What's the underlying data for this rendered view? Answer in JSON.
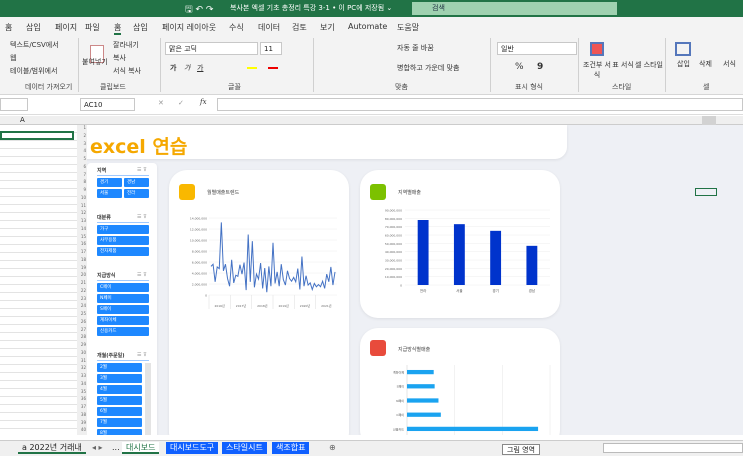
{
  "window": {
    "title": "복사본 엑셀 기초 총정리 특강 3-1 • 이 PC에 저장됨 ⌄",
    "search_placeholder": "검색"
  },
  "ribbon_tabs": [
    "홈",
    "삽입",
    "페이지",
    "파일",
    "홈",
    "삽입",
    "페이지 레이아웃",
    "수식",
    "데이터",
    "검토",
    "보기",
    "Automate",
    "도움말"
  ],
  "ribbon": {
    "data_group": {
      "items": [
        "텍스트/CSV에서",
        "웹",
        "테이블/범위에서"
      ],
      "label": "데이터 가져오기"
    },
    "clipboard": {
      "paste": "붙여넣기",
      "cut": "잘라내기",
      "copy": "복사",
      "format_painter": "서식 복사",
      "label": "클립보드"
    },
    "font": {
      "name": "맑은 고딕",
      "size": "11",
      "label": "글꼴",
      "bold": "가",
      "italic": "가",
      "underline": "가"
    },
    "align": {
      "wrap": "자동 줄 바꿈",
      "merge": "병합하고 가운데 맞춤",
      "label": "맞춤"
    },
    "number": {
      "format": "일반",
      "percent": "%",
      "comma": "9",
      "label": "표시 형식"
    },
    "styles": {
      "cond": "조건부 서식",
      "table": "표 서식",
      "cell": "셀 스타일",
      "label": "스타일"
    },
    "cells": {
      "insert": "삽입",
      "delete": "삭제",
      "format": "서식",
      "label": "셀"
    }
  },
  "formula_bar": {
    "name_box": "AC10",
    "fx": "fx",
    "value": ""
  },
  "left_pane": {
    "col": "A"
  },
  "dashboard": {
    "title": "excel 연습",
    "slicers": [
      {
        "title": "지역",
        "items": [
          "경기",
          "경남",
          "서울",
          "전라"
        ]
      },
      {
        "title": "대분류",
        "items": [
          "가구",
          "사무용품",
          "전자제품"
        ]
      },
      {
        "title": "지급방식",
        "items": [
          "C페이",
          "N페이",
          "S페이",
          "계좌이체",
          "신용카드"
        ]
      },
      {
        "title": "개월(주문일)",
        "items": [
          "2월",
          "3월",
          "4월",
          "5월",
          "6월",
          "7월",
          "8월",
          "9월"
        ]
      },
      {
        "title": "년(주문일)",
        "items": []
      }
    ]
  },
  "chart_data": [
    {
      "type": "line",
      "title": "월별매출트렌드",
      "ylim": [
        0,
        14000000
      ],
      "yticks": [
        "0",
        "2,000,000",
        "4,000,000",
        "6,000,000",
        "8,000,000",
        "10,000,000",
        "12,000,000",
        "14,000,000"
      ],
      "groups": [
        "2016년",
        "2017년",
        "2018년",
        "2019년",
        "2020년",
        "2021년"
      ],
      "values": [
        5.2,
        5.6,
        2.4,
        5.1,
        4.8,
        13.2,
        4.4,
        5.6,
        3.0,
        1.6,
        6.4,
        2.2,
        3.6,
        3.4,
        5.5,
        3.8,
        5.9,
        0.9,
        11.0,
        2.4,
        9.8,
        1.4,
        3.8,
        2.9,
        5.8,
        1.2,
        4.9,
        0.5,
        5.2,
        1.6,
        9.5,
        2.1,
        4.2,
        1.6,
        5.6,
        2.8,
        1.8,
        4.4,
        3.0,
        2.5,
        3.2,
        2.4,
        4.8,
        1.0,
        7.0,
        1.6,
        3.5,
        1.8,
        2.2,
        1.0,
        2.1,
        1.5,
        1.9,
        1.5,
        2.5,
        1.2,
        3.8,
        2.4,
        5.1,
        1.8,
        4.2
      ],
      "series_color": "#4472c4"
    },
    {
      "type": "bar",
      "title": "지역별매출",
      "categories": [
        "전라",
        "서울",
        "경기",
        "경남"
      ],
      "values": [
        78000000,
        73000000,
        65000000,
        47000000
      ],
      "ylim": [
        0,
        90000000
      ],
      "yticks": [
        "0",
        "10,000,000",
        "20,000,000",
        "30,000,000",
        "40,000,000",
        "50,000,000",
        "60,000,000",
        "70,000,000",
        "80,000,000",
        "90,000,000"
      ],
      "color": "#0033cc"
    },
    {
      "type": "bar",
      "orientation": "horizontal",
      "title": "지급방식별매출",
      "categories": [
        "계좌이체",
        "S페이",
        "N페이",
        "C페이",
        "신용카드"
      ],
      "values": [
        5.6,
        5.8,
        6.6,
        7.1,
        27.5
      ],
      "xlim": [
        0,
        30
      ],
      "color": "#1aa3f0"
    }
  ],
  "sheet_tabs": {
    "tabs": [
      "a 2022년 거래내",
      "대시보드",
      "대시보드도구",
      "스타일시트",
      "색조합표"
    ],
    "tooltip": "그림 영역",
    "ellipsis": "..."
  }
}
